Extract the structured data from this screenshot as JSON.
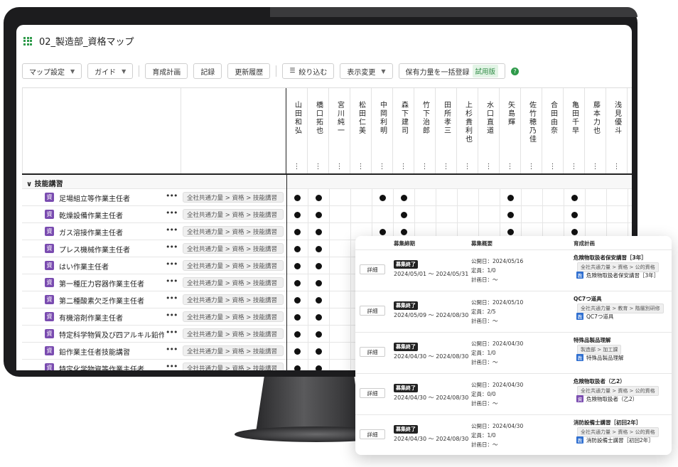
{
  "app": {
    "title": "02_製造部_資格マップ"
  },
  "toolbar": {
    "map_settings": "マップ設定",
    "guide": "ガイド",
    "training_plan": "育成計画",
    "record": "記録",
    "update_history": "更新履歴",
    "filter": "絞り込む",
    "display_change": "表示変更",
    "bulk_register": "保有力量を一括登録",
    "trial_badge": "試用版",
    "help": "?"
  },
  "persons": [
    "山田和弘",
    "橋口拓也",
    "宮川純一",
    "松田仁美",
    "中岡利明",
    "森下建司",
    "竹下治郎",
    "田所孝三",
    "上杉貴利也",
    "水口直道",
    "矢島輝",
    "佐竹穂乃佳",
    "合田由奈",
    "亀田千早",
    "藤本力也",
    "浅見優斗"
  ],
  "category": {
    "label": "技能講習"
  },
  "rows": [
    {
      "badge": "資",
      "name": "足場組立等作業主任者",
      "path": "全社共通力量 > 資格 > 技能講習",
      "marks": [
        1,
        1,
        0,
        0,
        1,
        1,
        0,
        0,
        0,
        0,
        1,
        0,
        0,
        1,
        0,
        0
      ]
    },
    {
      "badge": "資",
      "name": "乾燥設備作業主任者",
      "path": "全社共通力量 > 資格 > 技能講習",
      "marks": [
        1,
        1,
        0,
        0,
        0,
        1,
        0,
        0,
        0,
        0,
        1,
        0,
        0,
        1,
        0,
        0
      ]
    },
    {
      "badge": "資",
      "name": "ガス溶接作業主任者",
      "path": "全社共通力量 > 資格 > 技能講習",
      "marks": [
        1,
        1,
        0,
        0,
        1,
        1,
        0,
        0,
        0,
        0,
        1,
        0,
        0,
        1,
        0,
        0
      ]
    },
    {
      "badge": "資",
      "name": "プレス機械作業主任者",
      "path": "全社共通力量 > 資格 > 技能講習",
      "marks": [
        1,
        1,
        0,
        0,
        0,
        0,
        0,
        0,
        0,
        0,
        0,
        0,
        0,
        0,
        0,
        0
      ]
    },
    {
      "badge": "資",
      "name": "はい作業主任者",
      "path": "全社共通力量 > 資格 > 技能講習",
      "marks": [
        1,
        1,
        0,
        0,
        0,
        0,
        0,
        0,
        0,
        0,
        0,
        0,
        0,
        0,
        0,
        0
      ]
    },
    {
      "badge": "資",
      "name": "第一種圧力容器作業主任者",
      "path": "全社共通力量 > 資格 > 技能講習",
      "marks": [
        1,
        1,
        0,
        0,
        0,
        0,
        0,
        0,
        0,
        0,
        0,
        0,
        0,
        0,
        0,
        0
      ]
    },
    {
      "badge": "資",
      "name": "第二種酸素欠乏作業主任者",
      "path": "全社共通力量 > 資格 > 技能講習",
      "marks": [
        1,
        1,
        0,
        0,
        0,
        0,
        0,
        0,
        0,
        0,
        0,
        0,
        0,
        0,
        0,
        0
      ]
    },
    {
      "badge": "資",
      "name": "有機溶剤作業主任者",
      "path": "全社共通力量 > 資格 > 技能講習",
      "marks": [
        1,
        1,
        0,
        0,
        0,
        0,
        0,
        0,
        0,
        0,
        0,
        0,
        0,
        0,
        0,
        0
      ]
    },
    {
      "badge": "資",
      "name": "特定科学物質及び四アルキル鉛作業主任者",
      "path": "全社共通力量 > 資格 > 技能講習",
      "marks": [
        1,
        1,
        0,
        0,
        0,
        0,
        0,
        0,
        0,
        0,
        0,
        0,
        0,
        0,
        0,
        0
      ]
    },
    {
      "badge": "資",
      "name": "鉛作業主任者技能講習",
      "path": "全社共通力量 > 資格 > 技能講習",
      "marks": [
        1,
        1,
        0,
        0,
        0,
        0,
        0,
        0,
        0,
        0,
        0,
        0,
        0,
        0,
        0,
        0
      ]
    },
    {
      "badge": "資",
      "name": "特定化学物資等作業主任者",
      "path": "全社共通力量 > 資格 > 技能講習",
      "marks": [
        1,
        1,
        0,
        0,
        0,
        0,
        0,
        0,
        0,
        0,
        0,
        0,
        0,
        0,
        0,
        0
      ]
    }
  ],
  "card": {
    "headers": {
      "period": "募集締期",
      "summary": "募集概要",
      "plan": "育成計画"
    },
    "items": [
      {
        "detail": "詳細",
        "status": "募集終了",
        "period": "2024/05/01 ～ 2024/05/31",
        "published": "公開日：2024/05/16",
        "capacity": "定員：1/0",
        "plan_date": "計画日：～",
        "plan_title": "危険物取扱者保安講習［3年］",
        "plan_path": "全社共通力量 > 資格 > 公的資格",
        "plan_badge": "教",
        "plan_badge_color": "#2f6fd0",
        "plan_name": "危険物取扱者保安講習［3年］"
      },
      {
        "detail": "詳細",
        "status": "募集終了",
        "period": "2024/05/09 ～ 2024/08/30",
        "published": "公開日：2024/05/10",
        "capacity": "定員：2/5",
        "plan_date": "計画日：～",
        "plan_title": "QC7つ道具",
        "plan_path": "全社共通力量 > 教育 > 階層別研修",
        "plan_badge": "教",
        "plan_badge_color": "#2f6fd0",
        "plan_name": "QC7つ道具"
      },
      {
        "detail": "詳細",
        "status": "募集終了",
        "period": "2024/04/30 ～ 2024/08/30",
        "published": "公開日：2024/04/30",
        "capacity": "定員：1/0",
        "plan_date": "計画日：～",
        "plan_title": "特殊品製品理解",
        "plan_path": "製造部 > 加工課",
        "plan_badge": "教",
        "plan_badge_color": "#2f6fd0",
        "plan_name": "特殊品製品理解"
      },
      {
        "detail": "詳細",
        "status": "募集終了",
        "period": "2024/04/30 ～ 2024/08/30",
        "published": "公開日：2024/04/30",
        "capacity": "定員：0/0",
        "plan_date": "計画日：～",
        "plan_title": "危険物取扱者（乙2）",
        "plan_path": "全社共通力量 > 資格 > 公的資格",
        "plan_badge": "資",
        "plan_badge_color": "#7a4cb0",
        "plan_name": "危険物取扱者（乙2）"
      },
      {
        "detail": "詳細",
        "status": "募集終了",
        "period": "2024/04/30 ～ 2024/08/30",
        "published": "公開日：2024/04/30",
        "capacity": "定員：1/0",
        "plan_date": "計画日：～",
        "plan_title": "消防設備士講習［初回2年］",
        "plan_path": "全社共通力量 > 資格 > 公的資格",
        "plan_badge": "教",
        "plan_badge_color": "#2f6fd0",
        "plan_name": "消防設備士講習［初回2年］"
      }
    ]
  }
}
